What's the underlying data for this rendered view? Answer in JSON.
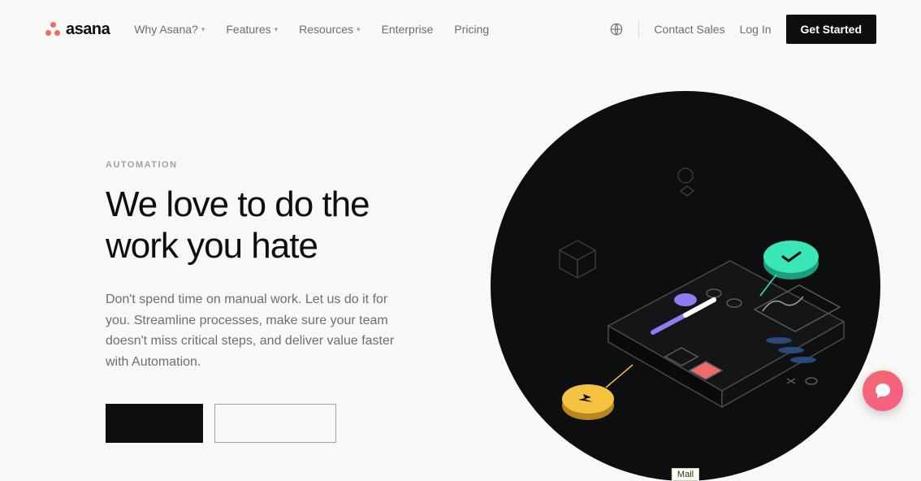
{
  "logo": {
    "text": "asana"
  },
  "nav": {
    "links": [
      {
        "label": "Why Asana?",
        "dropdown": true
      },
      {
        "label": "Features",
        "dropdown": true
      },
      {
        "label": "Resources",
        "dropdown": true
      },
      {
        "label": "Enterprise",
        "dropdown": false
      },
      {
        "label": "Pricing",
        "dropdown": false
      }
    ],
    "contact": "Contact Sales",
    "login": "Log In",
    "cta": "Get Started"
  },
  "hero": {
    "eyebrow": "AUTOMATION",
    "headline": "We love to do the work you hate",
    "subhead": "Don't spend time on manual work. Let us do it for you. Streamline processes, make sure your team doesn't miss critical steps, and deliver value faster with Automation."
  },
  "tooltip": "Mail"
}
